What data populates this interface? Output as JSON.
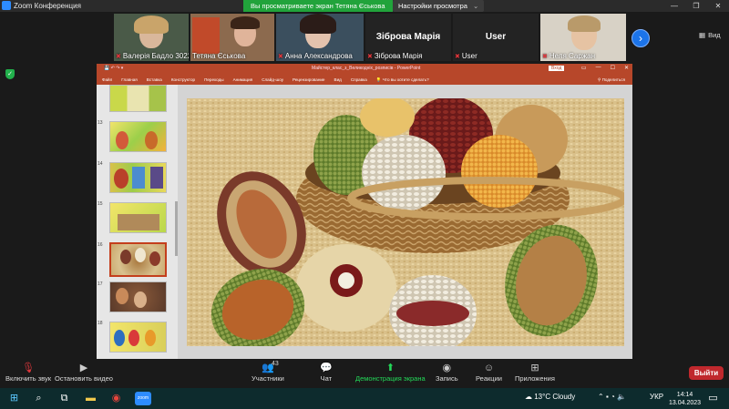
{
  "window": {
    "app_title": "Zoom Конференция",
    "share_banner": "Вы просматриваете экран Тетяна Єськова",
    "view_options": "Настройки просмотра",
    "view_label": "Вид"
  },
  "participants": [
    {
      "name": "Валерія Бадло 3022...",
      "muted": true,
      "video": true
    },
    {
      "name": "Тетяна Єськова",
      "muted": false,
      "video": true
    },
    {
      "name": "Анна Александрова",
      "muted": true,
      "video": true
    },
    {
      "name": "Зіброва Марія",
      "muted": true,
      "video": false,
      "display": "Зіброва Марія"
    },
    {
      "name": "User",
      "muted": true,
      "video": false,
      "display": "User"
    },
    {
      "name": "Неля Саржан",
      "muted": true,
      "video": true
    }
  ],
  "powerpoint": {
    "doc_title": "Майстер_клас_з_Великодніх_розписів  -  PowerPoint",
    "login": "Вход",
    "ribbon_tabs": [
      "Файл",
      "Главная",
      "Вставка",
      "Конструктор",
      "Переходы",
      "Анимация",
      "Слайд-шоу",
      "Рецензирование",
      "Вид",
      "Справка",
      "Что вы хотите сделать?"
    ],
    "share": "Поделиться",
    "slide_numbers": [
      "13",
      "14",
      "15",
      "16",
      "17",
      "18"
    ],
    "selected_slide": "16"
  },
  "toolbar": {
    "unmute": "Включить звук",
    "stop_video": "Остановить видео",
    "participants": "Участники",
    "participant_count": "43",
    "chat": "Чат",
    "share_screen": "Демонстрация экрана",
    "record": "Запись",
    "reactions": "Реакции",
    "apps": "Приложения",
    "leave": "Выйти"
  },
  "taskbar": {
    "weather": "13°C  Cloudy",
    "lang": "УКР",
    "time": "14:14",
    "date": "13.04.2023"
  },
  "colors": {
    "zoom_blue": "#2d8cff",
    "share_green": "#21a33b",
    "ppt_red": "#b7472a",
    "leave_red": "#c0282d"
  }
}
